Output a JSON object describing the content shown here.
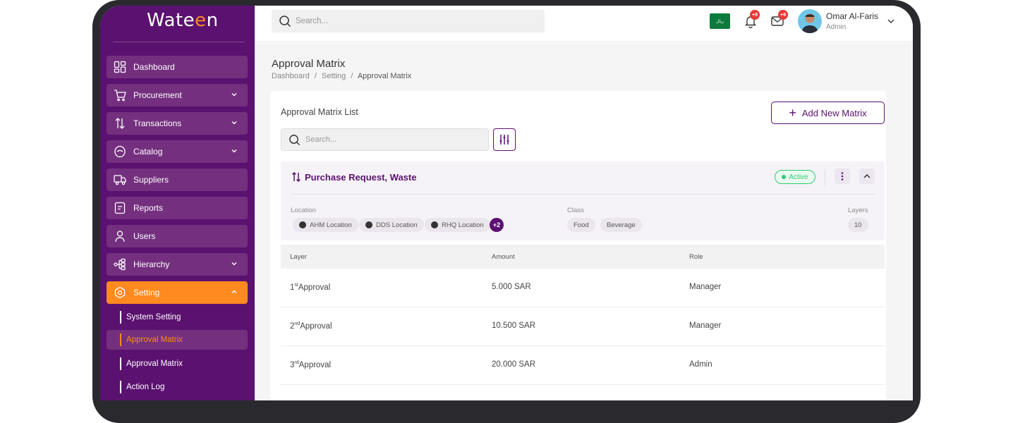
{
  "app": {
    "logo": "Wateen"
  },
  "sidebar": {
    "items": [
      {
        "label": "Dashboard",
        "icon": "dashboard-icon"
      },
      {
        "label": "Procurement",
        "icon": "cart-icon"
      },
      {
        "label": "Transactions",
        "icon": "transactions-icon"
      },
      {
        "label": "Catalog",
        "icon": "catalog-icon"
      },
      {
        "label": "Suppliers",
        "icon": "truck-icon"
      },
      {
        "label": "Reports",
        "icon": "reports-icon"
      },
      {
        "label": "Users",
        "icon": "user-icon"
      },
      {
        "label": "Hierarchy",
        "icon": "hierarchy-icon"
      },
      {
        "label": "Setting",
        "icon": "setting-icon"
      }
    ],
    "sub_items": [
      "System Setting",
      "Approval Matrix",
      "Approval Matrix",
      "Action Log"
    ]
  },
  "header": {
    "search_placeholder": "Search...",
    "flag_text": "ريال",
    "notifications_badge": "+9",
    "messages_badge": "+9",
    "user_name": "Omar Al-Faris",
    "user_role": "Admin"
  },
  "page": {
    "title": "Approval Matrix",
    "breadcrumb": [
      "Dashboard",
      "Setting",
      "Approval Matrix"
    ],
    "breadcrumb_sep": "/"
  },
  "list": {
    "title": "Approval Matrix List",
    "add_button": "Add New Matrix",
    "search_placeholder": "Search..."
  },
  "matrix": {
    "title": "Purchase Request, Waste",
    "status": "Active",
    "status_color": "#2ecc71",
    "location_label": "Location",
    "locations": [
      "AHM Location",
      "DDS Location",
      "RHQ Location"
    ],
    "more_locations": "+2",
    "class_label": "Class",
    "classes": [
      "Food",
      "Beverage"
    ],
    "layers_label": "Layers",
    "layers": "10"
  },
  "table": {
    "headers": [
      "Layer",
      "Amount",
      "Role"
    ],
    "rows": [
      {
        "num": "1",
        "sup": "st",
        "layer": "Approval",
        "amount": "5.000 SAR",
        "role": "Manager"
      },
      {
        "num": "2",
        "sup": "nd",
        "layer": "Approval",
        "amount": "10.500 SAR",
        "role": "Manager"
      },
      {
        "num": "3",
        "sup": "rd",
        "layer": "Approval",
        "amount": "20.000 SAR",
        "role": "Admin"
      }
    ]
  },
  "colors": {
    "primary": "#5b1170",
    "accent": "#ff8a1f"
  }
}
